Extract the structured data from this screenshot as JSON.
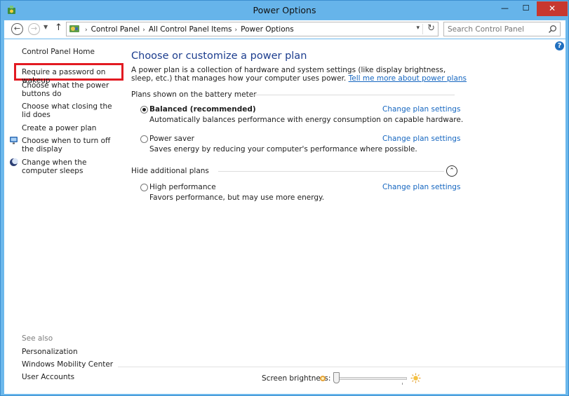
{
  "window": {
    "title": "Power Options",
    "minimize": "—",
    "maximize": "☐",
    "close": "✕"
  },
  "navigation": {
    "back": "←",
    "forward": "→",
    "recent": "▼",
    "up": "↑",
    "breadcrumbs": [
      "Control Panel",
      "All Control Panel Items",
      "Power Options"
    ],
    "separator": "›",
    "dropdown": "▾",
    "refresh": "↻"
  },
  "search": {
    "placeholder": "Search Control Panel"
  },
  "help": "?",
  "sidebar": {
    "items": [
      {
        "label": "Control Panel Home"
      },
      {
        "label": "Require a password on wakeup"
      },
      {
        "label": "Choose what the power buttons do"
      },
      {
        "label": "Choose what closing the lid does"
      },
      {
        "label": "Create a power plan"
      },
      {
        "label": "Choose when to turn off the display"
      },
      {
        "label": "Change when the computer sleeps"
      }
    ],
    "see_also": {
      "heading": "See also",
      "items": [
        {
          "label": "Personalization"
        },
        {
          "label": "Windows Mobility Center"
        },
        {
          "label": "User Accounts"
        }
      ]
    }
  },
  "main": {
    "title": "Choose or customize a power plan",
    "description": "A power plan is a collection of hardware and system settings (like display brightness, sleep, etc.) that manages how your computer uses power.",
    "learn_more": "Tell me more about power plans",
    "battery_section": "Plans shown on the battery meter",
    "hidden_section": "Hide additional plans",
    "plans": [
      {
        "name": "Balanced (recommended)",
        "description": "Automatically balances performance with energy consumption on capable hardware.",
        "link": "Change plan settings",
        "selected": true
      },
      {
        "name": "Power saver",
        "description": "Saves energy by reducing your computer's performance where possible.",
        "link": "Change plan settings",
        "selected": false
      },
      {
        "name": "High performance",
        "description": "Favors performance, but may use more energy.",
        "link": "Change plan settings",
        "selected": false
      }
    ],
    "collapse": "⌃"
  },
  "footer": {
    "brightness_label": "Screen brightness:",
    "brightness_level": 0.0
  },
  "colors": {
    "highlight_box": "#e21a22",
    "link": "#1566c0",
    "title": "#1c3d8e"
  }
}
